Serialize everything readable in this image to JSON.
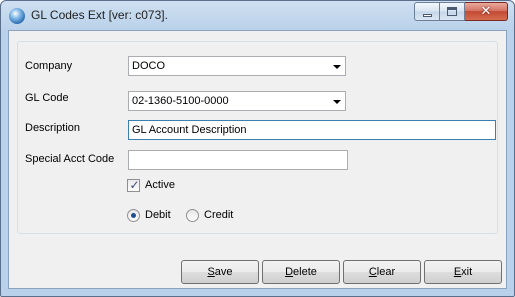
{
  "window": {
    "title": "GL Codes Ext [ver: c073].",
    "min_icon": "minimize-icon",
    "max_icon": "maximize-icon",
    "close_icon": "close-icon",
    "close_glyph": "✕"
  },
  "form": {
    "company": {
      "label": "Company",
      "value": "DOCO"
    },
    "gl_code": {
      "label": "GL Code",
      "value": "02-1360-5100-0000"
    },
    "description": {
      "label": "Description",
      "value": "GL Account Description"
    },
    "special_acct_code": {
      "label": "Special Acct Code",
      "value": ""
    },
    "active": {
      "label": "Active",
      "checked": true,
      "glyph": "✓"
    },
    "debit": {
      "label": "Debit",
      "selected": true
    },
    "credit": {
      "label": "Credit",
      "selected": false
    }
  },
  "buttons": {
    "save": {
      "first": "S",
      "rest": "ave"
    },
    "delete": {
      "first": "D",
      "rest": "elete"
    },
    "clear": {
      "first": "C",
      "rest": "lear"
    },
    "exit": {
      "first": "E",
      "rest": "xit"
    }
  }
}
